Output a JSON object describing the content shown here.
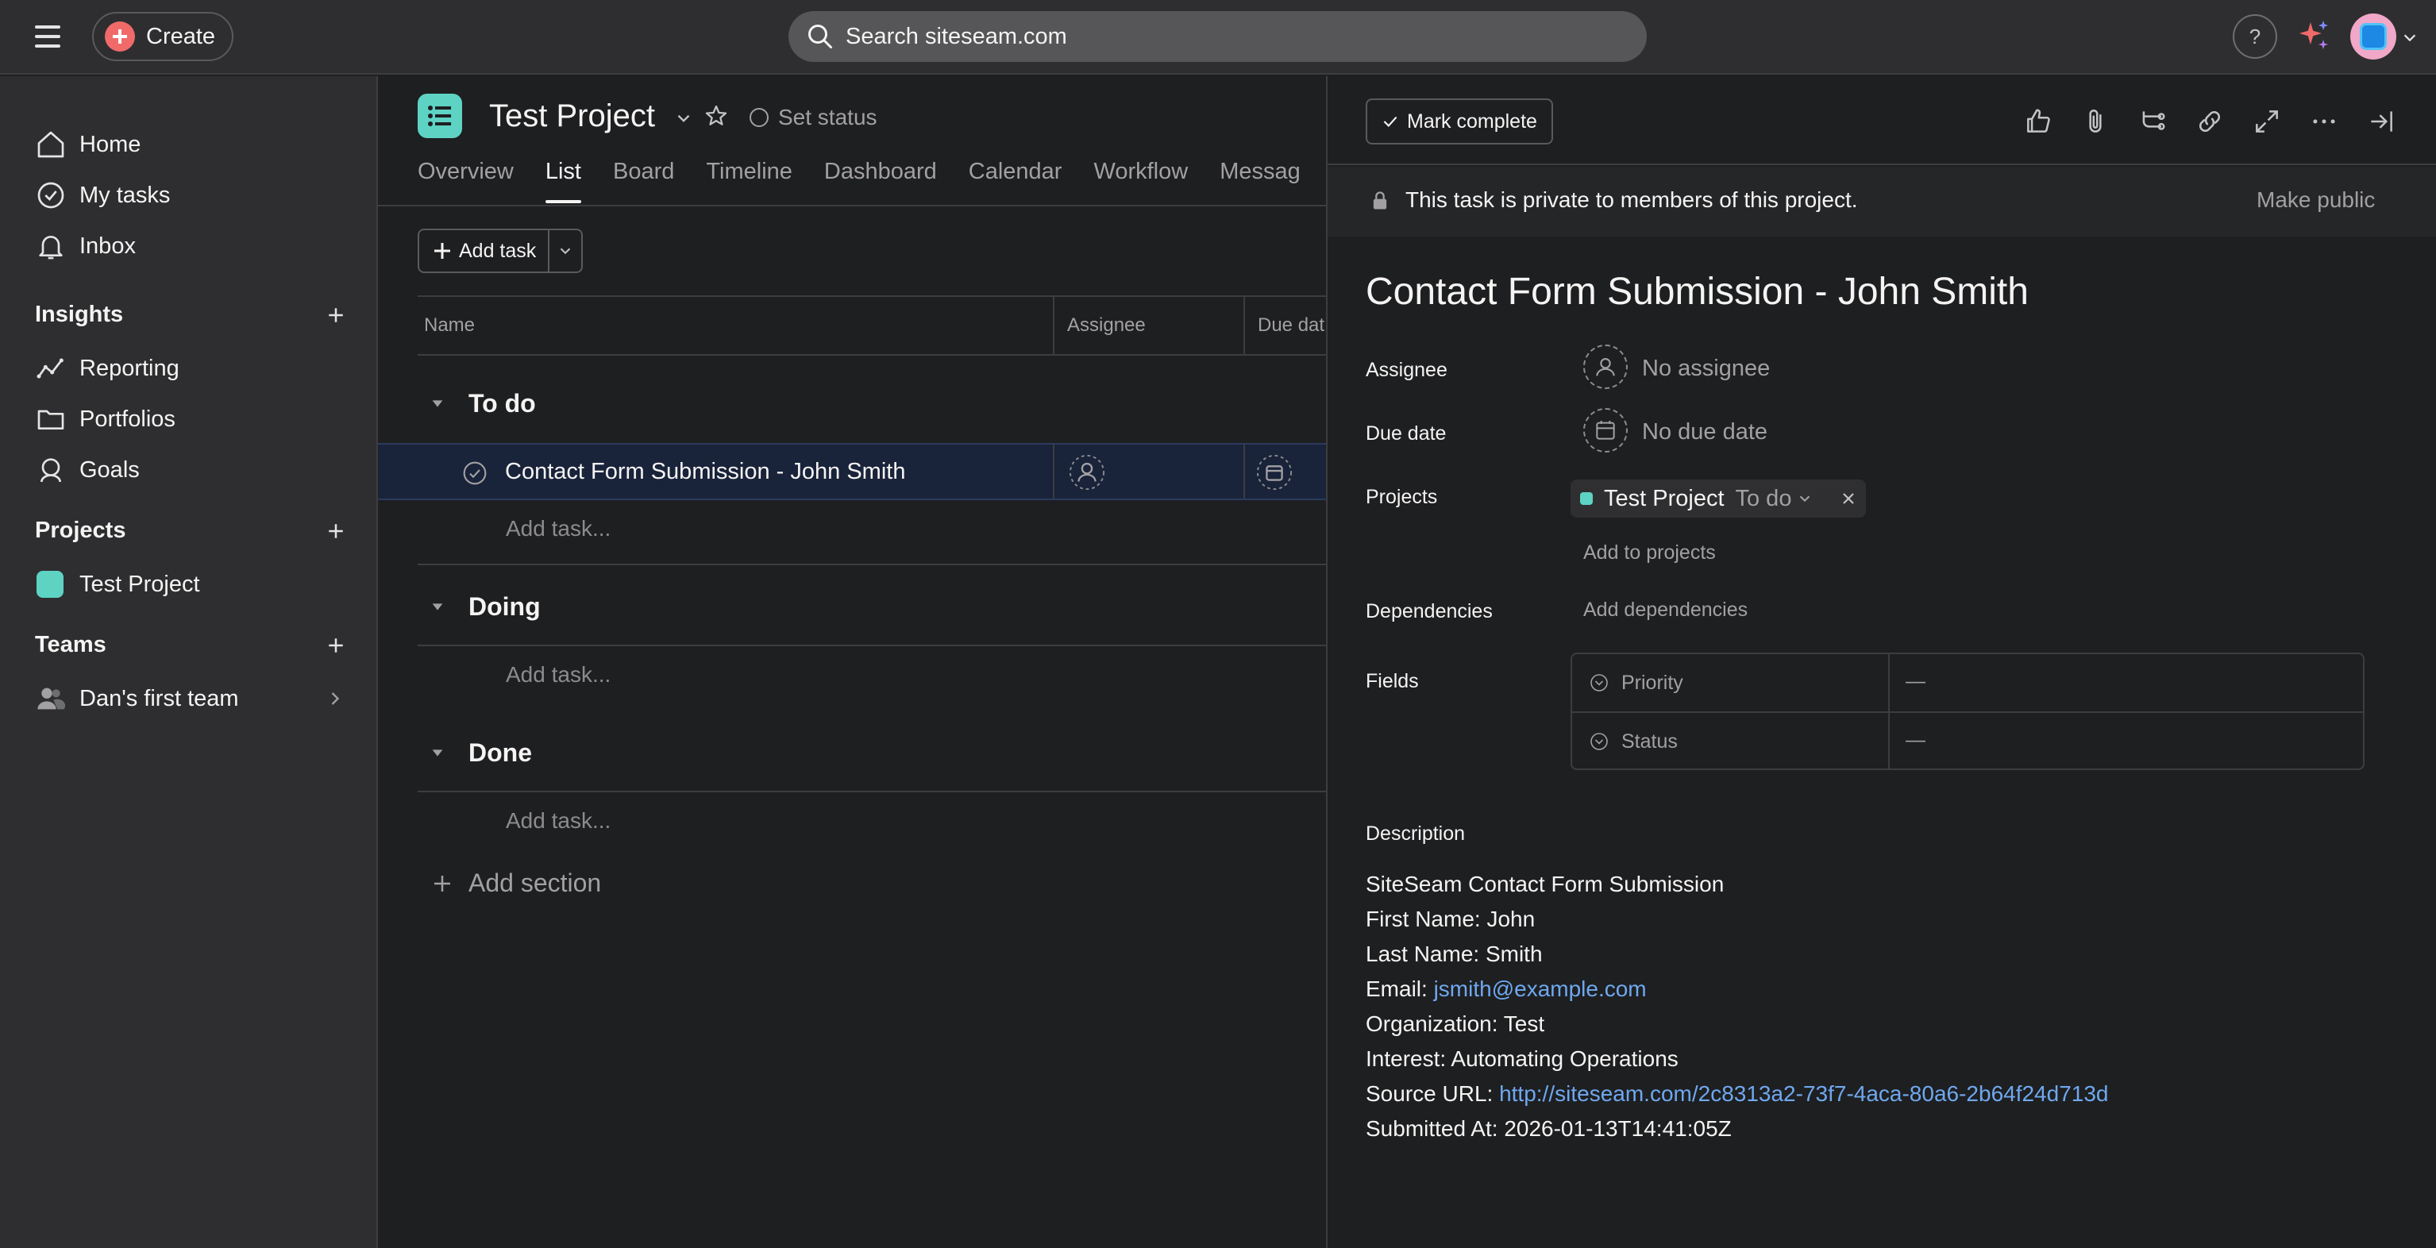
{
  "topbar": {
    "create_label": "Create",
    "search_placeholder": "Search siteseam.com",
    "help_label": "?"
  },
  "sidebar": {
    "nav": [
      {
        "label": "Home",
        "icon": "home-icon"
      },
      {
        "label": "My tasks",
        "icon": "check-circle-icon"
      },
      {
        "label": "Inbox",
        "icon": "bell-icon"
      }
    ],
    "insights": {
      "heading": "Insights",
      "items": [
        {
          "label": "Reporting",
          "icon": "chart-line-icon"
        },
        {
          "label": "Portfolios",
          "icon": "folder-icon"
        },
        {
          "label": "Goals",
          "icon": "goals-icon"
        }
      ]
    },
    "projects": {
      "heading": "Projects",
      "items": [
        {
          "label": "Test Project",
          "color": "#5ed3c4"
        }
      ]
    },
    "teams": {
      "heading": "Teams",
      "items": [
        {
          "label": "Dan's first team",
          "icon": "people-icon"
        }
      ]
    }
  },
  "project": {
    "title": "Test Project",
    "set_status": "Set status",
    "tabs": [
      "Overview",
      "List",
      "Board",
      "Timeline",
      "Dashboard",
      "Calendar",
      "Workflow",
      "Messag"
    ],
    "active_tab": "List",
    "add_task_label": "Add task",
    "columns": {
      "name": "Name",
      "assignee": "Assignee",
      "due_date": "Due dat"
    },
    "sections": [
      {
        "name": "To do",
        "tasks": [
          "Contact Form Submission - John Smith"
        ],
        "add_task": "Add task..."
      },
      {
        "name": "Doing",
        "tasks": [],
        "add_task": "Add task..."
      },
      {
        "name": "Done",
        "tasks": [],
        "add_task": "Add task..."
      }
    ],
    "add_section": "Add section"
  },
  "detail": {
    "mark_complete": "Mark complete",
    "private_notice": "This task is private to members of this project.",
    "make_public": "Make public",
    "title": "Contact Form Submission - John Smith",
    "assignee_label": "Assignee",
    "assignee_value": "No assignee",
    "due_label": "Due date",
    "due_value": "No due date",
    "projects_label": "Projects",
    "project_name": "Test Project",
    "project_section": "To do",
    "add_to_projects": "Add to projects",
    "dependencies_label": "Dependencies",
    "add_dependencies": "Add dependencies",
    "fields_label": "Fields",
    "fields": [
      {
        "name": "Priority",
        "value": "—"
      },
      {
        "name": "Status",
        "value": "—"
      }
    ],
    "description_label": "Description",
    "description": {
      "heading": "SiteSeam Contact Form Submission",
      "first_name": "First Name: John",
      "last_name": "Last Name: Smith",
      "email_prefix": "Email: ",
      "email": "jsmith@example.com",
      "organization": "Organization: Test",
      "interest": "Interest: Automating Operations",
      "source_prefix": "Source URL: ",
      "source_url": "http://siteseam.com/2c8313a2-73f7-4aca-80a6-2b64f24d713d",
      "submitted": "Submitted At: 2026-01-13T14:41:05Z"
    }
  }
}
